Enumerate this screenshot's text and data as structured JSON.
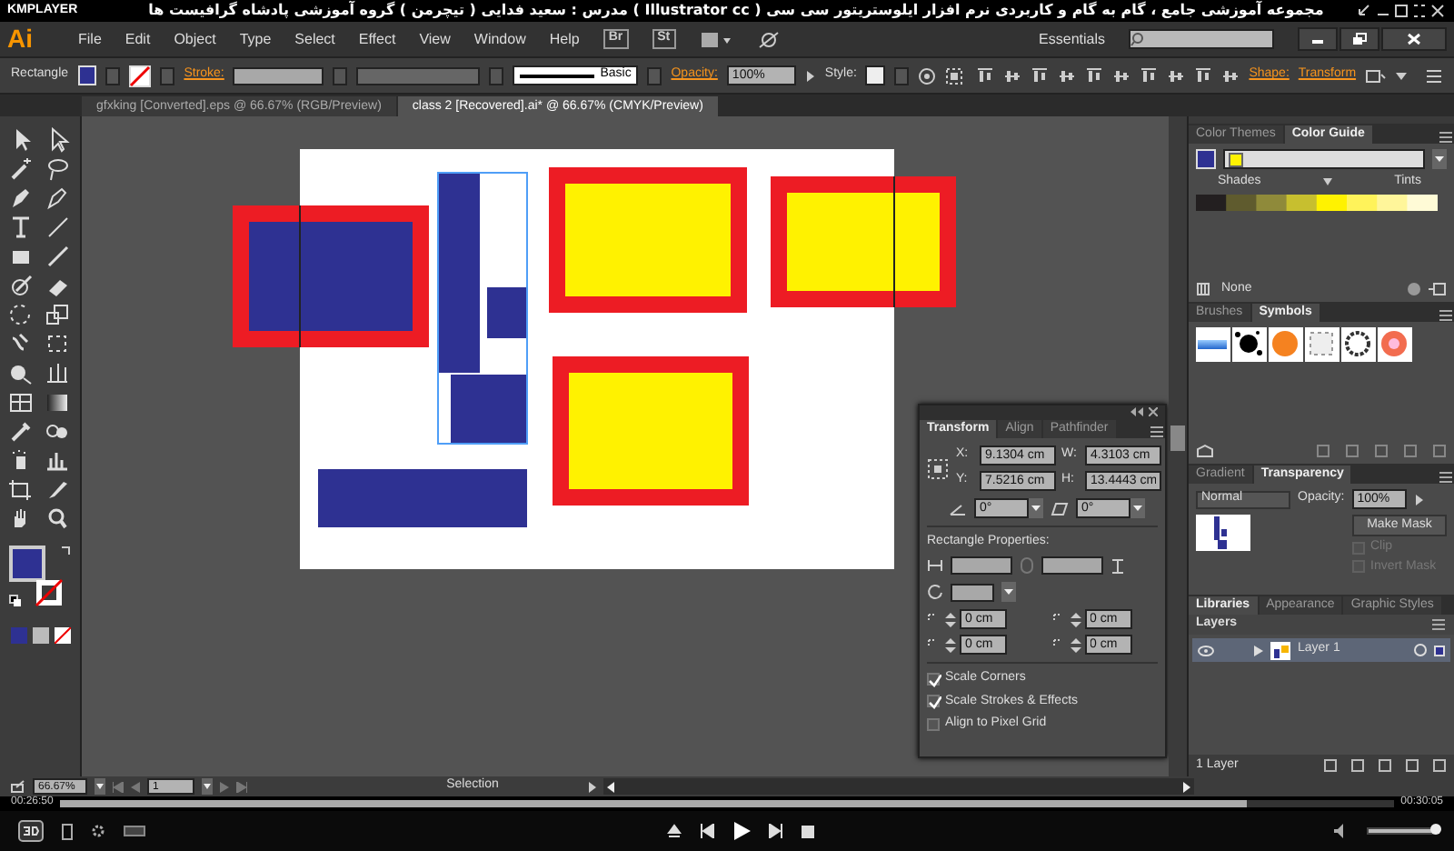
{
  "player": {
    "name": "KMPLAYER",
    "video_title": "مجموعه آموزشی جامع ، گام به گام و کاربردی نرم افزار ایلوستریتور سی سی ( Illustrator cc )   مدرس : سعید فدایی ( تیچرمن ) گروه آموزشی پادشاه گرافیست ها"
  },
  "app": {
    "logo": "Ai",
    "menus": [
      "File",
      "Edit",
      "Object",
      "Type",
      "Select",
      "Effect",
      "View",
      "Window",
      "Help"
    ],
    "bridge": "Br",
    "stock": "St",
    "workspace": "Essentials"
  },
  "control_bar": {
    "selection": "Rectangle",
    "stroke_label": "Stroke:",
    "brush": "Basic",
    "opacity_label": "Opacity:",
    "opacity": "100%",
    "style_label": "Style:",
    "shape_link": "Shape:",
    "transform_link": "Transform"
  },
  "doc_tabs": [
    {
      "label": "gfxking [Converted].eps @ 66.67% (RGB/Preview)",
      "selected": false
    },
    {
      "label": "class 2 [Recovered].ai* @ 66.67% (CMYK/Preview)",
      "selected": true
    }
  ],
  "transform_panel": {
    "tabs": [
      {
        "label": "Transform",
        "selected": true
      },
      {
        "label": "Align",
        "selected": false
      },
      {
        "label": "Pathfinder",
        "selected": false
      }
    ],
    "fields": [
      {
        "label": "X:",
        "value": "9.1304 cm"
      },
      {
        "label": "W:",
        "value": "4.3103 cm"
      },
      {
        "label": "Y:",
        "value": "7.5216 cm"
      },
      {
        "label": "H:",
        "value": "13.4443 cm"
      }
    ],
    "rotate": "0°",
    "shear": "0°",
    "section": "Rectangle Properties:",
    "corners": [
      "0 cm",
      "0 cm",
      "0 cm",
      "0 cm"
    ],
    "options": [
      {
        "label": "Scale Corners",
        "checked": true
      },
      {
        "label": "Scale Strokes & Effects",
        "checked": true
      },
      {
        "label": "Align to Pixel Grid",
        "checked": false
      }
    ]
  },
  "color_panel": {
    "tabs": [
      {
        "label": "Color Themes",
        "selected": false
      },
      {
        "label": "Color Guide",
        "selected": true
      }
    ],
    "shades": "Shades",
    "tints": "Tints",
    "none": "None"
  },
  "symbols_panel": {
    "tabs": [
      {
        "label": "Brushes",
        "selected": false
      },
      {
        "label": "Symbols",
        "selected": true
      }
    ]
  },
  "transparency_panel": {
    "tabs": [
      {
        "label": "Gradient",
        "selected": false
      },
      {
        "label": "Transparency",
        "selected": true
      }
    ],
    "blend_mode": "Normal",
    "opacity_label": "Opacity:",
    "opacity": "100%",
    "make_mask": "Make Mask",
    "options": [
      {
        "label": "Clip",
        "checked": false,
        "disabled": true
      },
      {
        "label": "Invert Mask",
        "checked": false,
        "disabled": true
      }
    ]
  },
  "library_tabs": [
    {
      "label": "Libraries",
      "selected": true
    },
    {
      "label": "Appearance",
      "selected": false
    },
    {
      "label": "Graphic Styles",
      "selected": false
    }
  ],
  "layers_panel": {
    "title": "Layers",
    "layers": [
      {
        "name": "Layer 1",
        "selected": true
      }
    ],
    "count": "1 Layer"
  },
  "status_bar": {
    "zoom": "66.67%",
    "artboard": "1",
    "tool": "Selection"
  },
  "playback": {
    "elapsed": "00:26:50",
    "total": "00:30:05",
    "level": 0.89,
    "volume": {
      "level": 1
    }
  }
}
